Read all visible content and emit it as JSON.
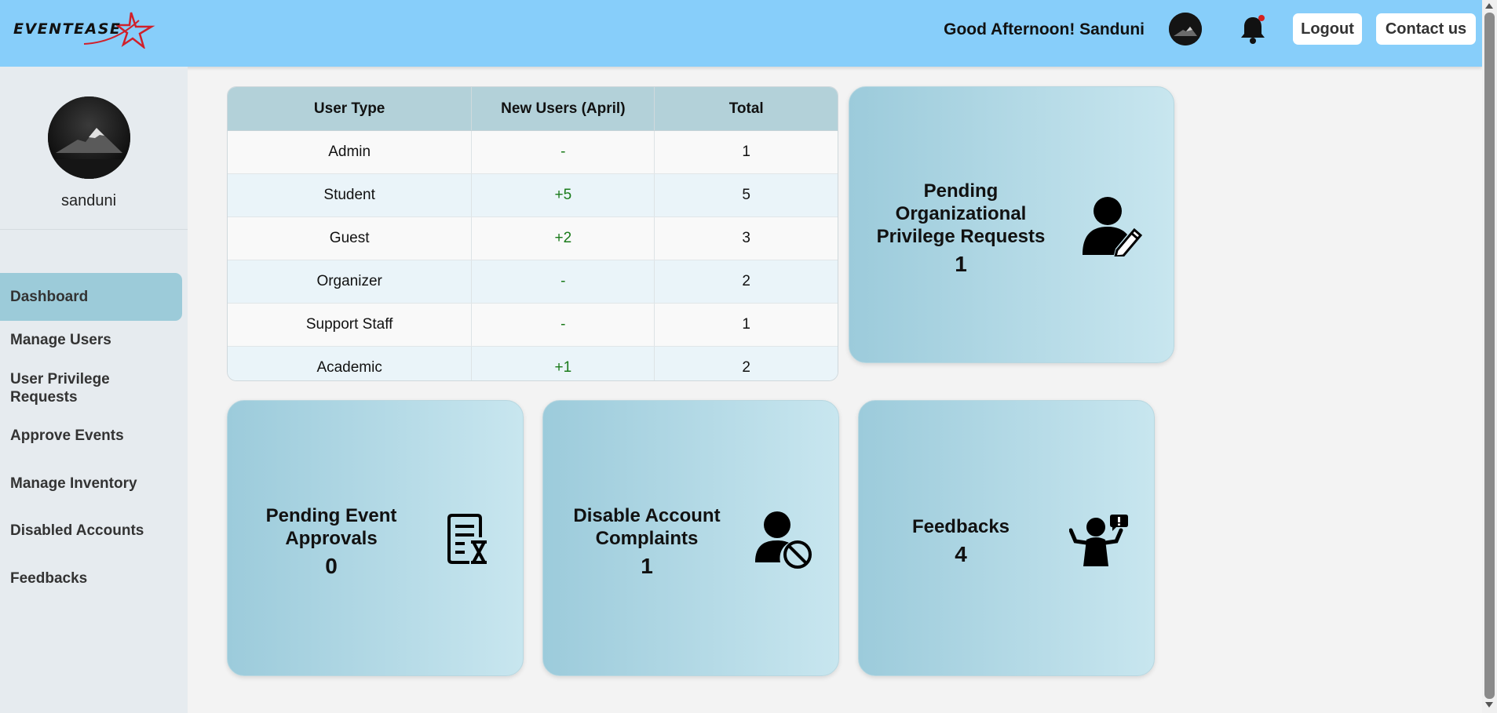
{
  "header": {
    "logo_text": "EVENTEASE",
    "greeting": "Good Afternoon! Sanduni",
    "logout_label": "Logout",
    "contact_label": "Contact us"
  },
  "sidebar": {
    "username": "sanduni",
    "items": [
      {
        "label": "Dashboard",
        "active": true
      },
      {
        "label": "Manage Users"
      },
      {
        "label": "User Privilege Requests"
      },
      {
        "label": "Approve Events"
      },
      {
        "label": "Manage Inventory"
      },
      {
        "label": "Disabled Accounts"
      },
      {
        "label": "Feedbacks"
      }
    ]
  },
  "user_table": {
    "headers": [
      "User Type",
      "New Users (April)",
      "Total"
    ],
    "rows": [
      {
        "type": "Admin",
        "new": "-",
        "total": "1"
      },
      {
        "type": "Student",
        "new": "+5",
        "total": "5"
      },
      {
        "type": "Guest",
        "new": "+2",
        "total": "3"
      },
      {
        "type": "Organizer",
        "new": "-",
        "total": "2"
      },
      {
        "type": "Support Staff",
        "new": "-",
        "total": "1"
      },
      {
        "type": "Academic",
        "new": "+1",
        "total": "2"
      }
    ]
  },
  "cards": {
    "privilege": {
      "title": "Pending Organizational Privilege Requests",
      "value": "1",
      "icon": "user-edit-icon"
    },
    "events": {
      "title": "Pending Event Approvals",
      "value": "0",
      "icon": "document-hourglass-icon"
    },
    "complaints": {
      "title": "Disable Account Complaints",
      "value": "1",
      "icon": "user-blocked-icon"
    },
    "feedbacks": {
      "title": "Feedbacks",
      "value": "4",
      "icon": "feedback-person-icon"
    }
  },
  "colors": {
    "header_bg": "#87cefa",
    "sidebar_bg": "#e6ebef",
    "active_nav": "#9ccbd9",
    "positive_text": "#1a7a1a"
  }
}
